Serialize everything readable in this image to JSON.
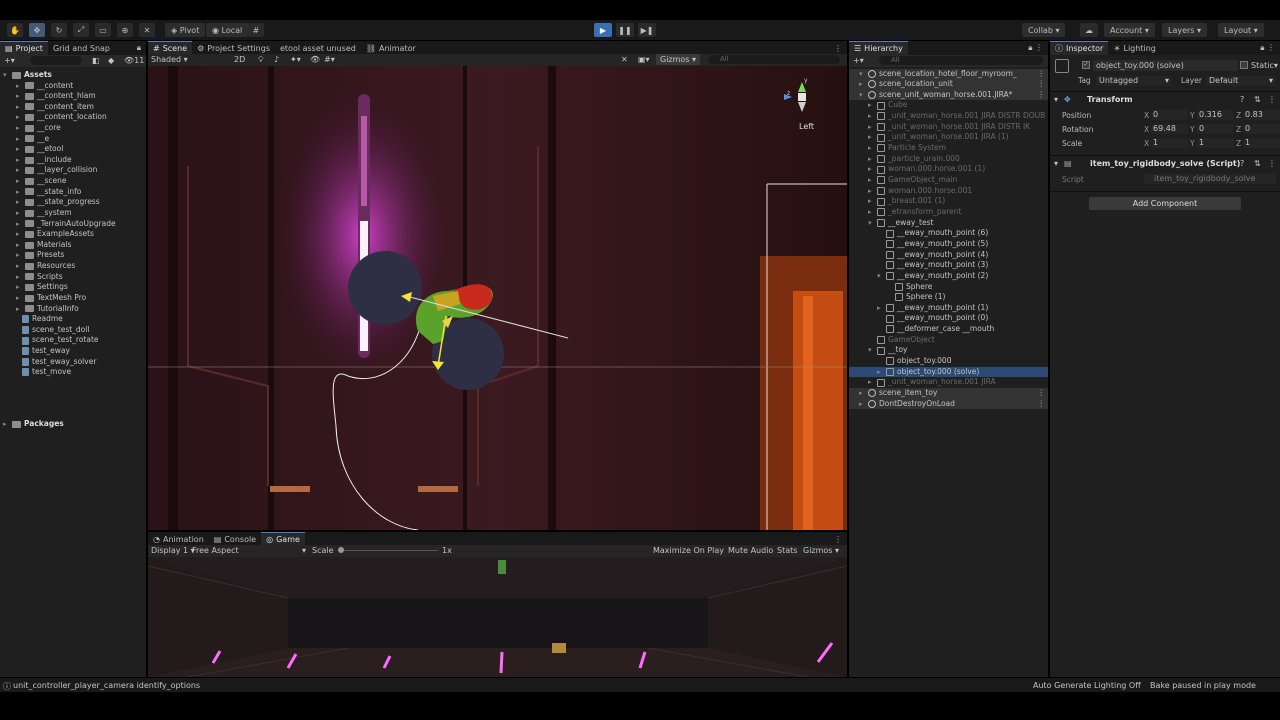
{
  "toolbar": {
    "pivot": "Pivot",
    "local": "Local",
    "collab": "Collab",
    "account": "Account",
    "layers": "Layers",
    "layout": "Layout"
  },
  "project": {
    "tabs": [
      "Project",
      "Grid and Snap"
    ],
    "count": "11",
    "root": "Assets",
    "items": [
      "__content",
      "__content_hlam",
      "__content_item",
      "__content_location",
      "__core",
      "__e",
      "__etool",
      "__include",
      "__layer_collision",
      "__scene",
      "__state_info",
      "__state_progress",
      "__system",
      "_TerrainAutoUpgrade",
      "ExampleAssets",
      "Materials",
      "Presets",
      "Resources",
      "Scripts",
      "Settings",
      "TextMesh Pro",
      "TutorialInfo"
    ],
    "files": [
      "Readme",
      "scene_test_doll",
      "scene_test_rotate",
      "test_eway",
      "test_eway_solver",
      "test_move"
    ],
    "packages": "Packages"
  },
  "scene": {
    "tabs": [
      "Scene",
      "Project Settings",
      "etool asset unused",
      "Animator"
    ],
    "shading": "Shaded",
    "mode2d": "2D",
    "gizmos": "Gizmos",
    "search_placeholder": "All",
    "view_label": "Left"
  },
  "game": {
    "tabs": [
      "Animation",
      "Console",
      "Game"
    ],
    "display": "Display 1",
    "aspect": "Free Aspect",
    "scale_label": "Scale",
    "scale_value": "1x",
    "maximize": "Maximize On Play",
    "mute": "Mute Audio",
    "stats": "Stats",
    "gizmos": "Gizmos"
  },
  "hierarchy": {
    "tab": "Hierarchy",
    "search_placeholder": "All",
    "rows": [
      {
        "t": "scene_location_hotel_floor_myroom_",
        "type": "scene"
      },
      {
        "t": "scene_location_unit",
        "type": "scene"
      },
      {
        "t": "scene_unit_woman_horse.001.JIRA*",
        "type": "scene"
      },
      {
        "t": "Cube",
        "type": "dim"
      },
      {
        "t": "_unit_woman_horse.001 JIRA DISTR DOUB",
        "type": "dim"
      },
      {
        "t": "_unit_woman_horse.001 JIRA DISTR IK",
        "type": "dim"
      },
      {
        "t": "_unit_woman_horse.001 JIRA (1)",
        "type": "dim"
      },
      {
        "t": "Particle System",
        "type": "dim"
      },
      {
        "t": "_particle_urain.000",
        "type": "dim"
      },
      {
        "t": "woman.000.horse.001 (1)",
        "type": "dim"
      },
      {
        "t": "GameObject_main",
        "type": "dim"
      },
      {
        "t": "woman.000.horse.001",
        "type": "dim"
      },
      {
        "t": "_breast.001 (1)",
        "type": "dim"
      },
      {
        "t": "_etransform_parent",
        "type": "dim"
      },
      {
        "t": "__eway_test",
        "type": "obj"
      },
      {
        "t": "__eway_mouth_point (6)",
        "type": "obj"
      },
      {
        "t": "__eway_mouth_point (5)",
        "type": "obj"
      },
      {
        "t": "__eway_mouth_point (4)",
        "type": "obj"
      },
      {
        "t": "__eway_mouth_point (3)",
        "type": "obj"
      },
      {
        "t": "__eway_mouth_point (2)",
        "type": "obj"
      },
      {
        "t": "Sphere",
        "type": "obj"
      },
      {
        "t": "Sphere (1)",
        "type": "obj"
      },
      {
        "t": "__eway_mouth_point (1)",
        "type": "obj"
      },
      {
        "t": "__eway_mouth_point (0)",
        "type": "obj"
      },
      {
        "t": "__deformer_case __mouth",
        "type": "obj"
      },
      {
        "t": "GameObject",
        "type": "dim"
      },
      {
        "t": "__toy",
        "type": "obj"
      },
      {
        "t": "object_toy.000",
        "type": "obj"
      },
      {
        "t": "object_toy.000 (solve)",
        "type": "sel"
      },
      {
        "t": "_unit_woman_horse.001 JIRA",
        "type": "dim"
      },
      {
        "t": "scene_item_toy",
        "type": "scene"
      },
      {
        "t": "DontDestroyOnLoad",
        "type": "scene"
      }
    ]
  },
  "inspector": {
    "tabs": [
      "Inspector",
      "Lighting"
    ],
    "object_name": "object_toy.000 (solve)",
    "static": "Static",
    "tag_label": "Tag",
    "tag": "Untagged",
    "layer_label": "Layer",
    "layer": "Default",
    "transform": "Transform",
    "position_label": "Position",
    "rotation_label": "Rotation",
    "scale_label": "Scale",
    "pos": {
      "x": "0",
      "y": "0.316",
      "z": "0.83"
    },
    "rot": {
      "x": "69.48",
      "y": "0",
      "z": "0"
    },
    "scl": {
      "x": "1",
      "y": "1",
      "z": "1"
    },
    "component": "item_toy_rigidbody_solve (Script)",
    "script_label": "Script",
    "script_value": "item_toy_rigidbody_solve",
    "add_component": "Add Component"
  },
  "status": {
    "message": "unit_controller_player_camera identify_options",
    "lighting": "Auto Generate Lighting Off",
    "bake": "Bake paused in play mode"
  },
  "colors": {
    "accent": "#3b6fb3",
    "selection": "#2c4a75",
    "panel": "#1f1f1f"
  }
}
